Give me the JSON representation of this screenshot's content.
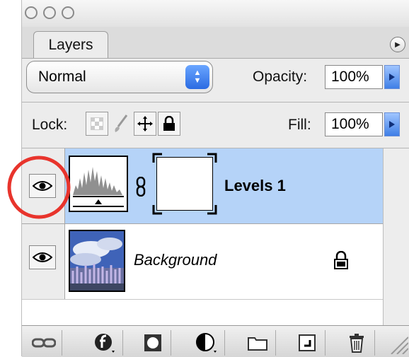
{
  "panel": {
    "tab_label": "Layers",
    "blend_mode": "Normal",
    "opacity_label": "Opacity:",
    "opacity_value": "100%",
    "lock_label": "Lock:",
    "fill_label": "Fill:",
    "fill_value": "100%"
  },
  "layers": [
    {
      "name": "Levels 1",
      "selected": true
    },
    {
      "name": "Background",
      "selected": false
    }
  ],
  "colors": {
    "selected_row": "#b5d3f8",
    "annotation_circle": "#e8342c"
  },
  "icons": [
    "link-icon",
    "layer-style-icon",
    "mask-icon",
    "adjustment-icon",
    "folder-icon",
    "new-layer-icon",
    "trash-icon"
  ]
}
